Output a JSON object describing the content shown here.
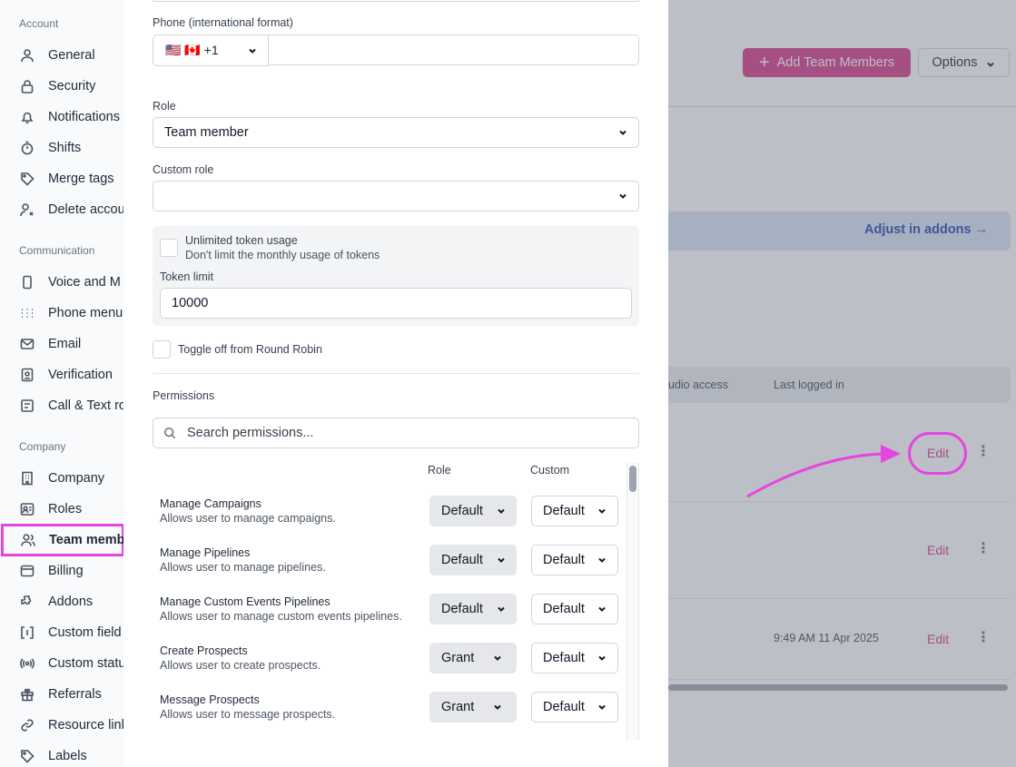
{
  "sidebar": {
    "sections": [
      {
        "label": "Account",
        "items": [
          {
            "label": "General",
            "icon": "user-icon"
          },
          {
            "label": "Security",
            "icon": "lock-icon"
          },
          {
            "label": "Notifications",
            "icon": "bell-icon"
          },
          {
            "label": "Shifts",
            "icon": "stopwatch-icon"
          },
          {
            "label": "Merge tags",
            "icon": "tag-icon"
          },
          {
            "label": "Delete accou",
            "icon": "user-x-icon"
          }
        ]
      },
      {
        "label": "Communication",
        "items": [
          {
            "label": "Voice and M",
            "icon": "phone-device-icon"
          },
          {
            "label": "Phone menu",
            "icon": "dots-grid-icon"
          },
          {
            "label": "Email",
            "icon": "mail-icon"
          },
          {
            "label": "Verification",
            "icon": "id-card-icon"
          },
          {
            "label": "Call & Text ro",
            "icon": "routing-icon"
          }
        ]
      },
      {
        "label": "Company",
        "items": [
          {
            "label": "Company",
            "icon": "building-icon"
          },
          {
            "label": "Roles",
            "icon": "roles-icon"
          },
          {
            "label": "Team memb",
            "icon": "users-icon"
          },
          {
            "label": "Billing",
            "icon": "wallet-icon"
          },
          {
            "label": "Addons",
            "icon": "puzzle-icon"
          },
          {
            "label": "Custom field",
            "icon": "brackets-icon"
          },
          {
            "label": "Custom statu",
            "icon": "broadcast-icon"
          },
          {
            "label": "Referrals",
            "icon": "gift-icon"
          },
          {
            "label": "Resource link",
            "icon": "link-icon"
          },
          {
            "label": "Labels",
            "icon": "label-icon"
          }
        ]
      }
    ]
  },
  "background": {
    "add_button": "Add Team Members",
    "options_button": "Options",
    "addon_link": "Adjust in addons →",
    "table_headers": {
      "studio": "udio access",
      "last_logged": "Last logged in"
    },
    "rows": [
      {
        "edit": "Edit",
        "last_logged": ""
      },
      {
        "edit": "Edit",
        "last_logged": ""
      },
      {
        "edit": "Edit",
        "last_logged": "9:49 AM 11 Apr 2025"
      }
    ]
  },
  "modal": {
    "phone_label": "Phone (international format)",
    "phone_country": "🇺🇸 🇨🇦 +1",
    "phone_value": "",
    "role_label": "Role",
    "role_value": "Team member",
    "custom_role_label": "Custom role",
    "custom_role_value": "",
    "unlimited_title": "Unlimited token usage",
    "unlimited_desc": "Don't limit the monthly usage of tokens",
    "token_limit_label": "Token limit",
    "token_limit_value": "10000",
    "round_robin_label": "Toggle off from Round Robin",
    "permissions_label": "Permissions",
    "search_placeholder": "Search permissions...",
    "col_role": "Role",
    "col_custom": "Custom",
    "permissions": [
      {
        "name": "Manage Campaigns",
        "desc": "Allows user to manage campaigns.",
        "role": "Default",
        "custom": "Default"
      },
      {
        "name": "Manage Pipelines",
        "desc": "Allows user to manage pipelines.",
        "role": "Default",
        "custom": "Default"
      },
      {
        "name": "Manage Custom Events Pipelines",
        "desc": "Allows user to manage custom events pipelines.",
        "role": "Default",
        "custom": "Default"
      },
      {
        "name": "Create Prospects",
        "desc": "Allows user to create prospects.",
        "role": "Grant",
        "custom": "Default"
      },
      {
        "name": "Message Prospects",
        "desc": "Allows user to message prospects.",
        "role": "Grant",
        "custom": "Default"
      }
    ]
  },
  "colors": {
    "accent": "#d63384",
    "annotation": "#e545e0",
    "link": "#1e40af"
  }
}
